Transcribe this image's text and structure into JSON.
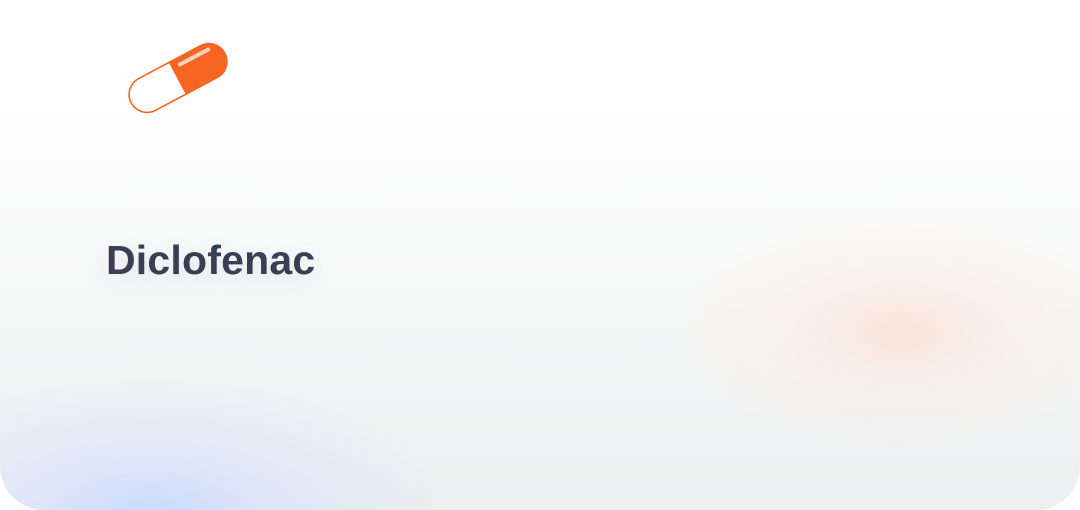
{
  "drug": {
    "name": "Diclofenac",
    "icon": "capsule-icon",
    "accent_color": "#f76522"
  }
}
